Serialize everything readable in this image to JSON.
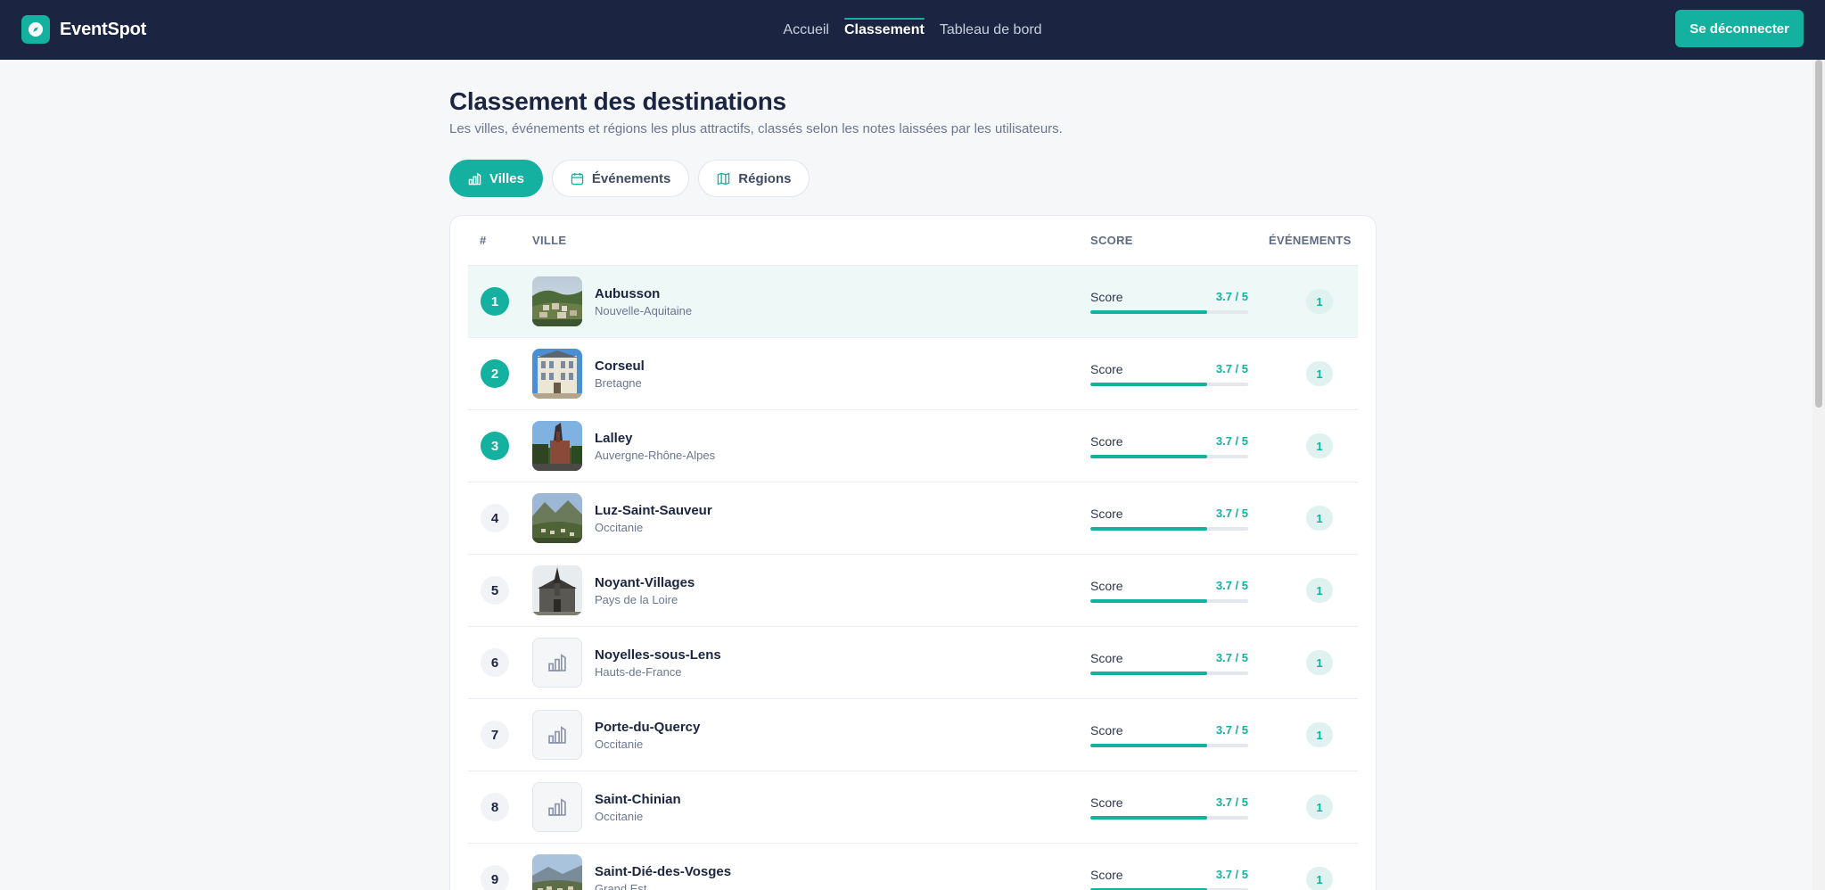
{
  "header": {
    "brand": "EventSpot",
    "nav": [
      {
        "label": "Accueil",
        "active": false
      },
      {
        "label": "Classement",
        "active": true
      },
      {
        "label": "Tableau de bord",
        "active": false
      }
    ],
    "logout_label": "Se déconnecter"
  },
  "page": {
    "title": "Classement des destinations",
    "subtitle": "Les villes, événements et régions les plus attractifs, classés selon les notes laissées par les utilisateurs."
  },
  "tabs": [
    {
      "label": "Villes",
      "icon": "chart-bar-icon",
      "active": true
    },
    {
      "label": "Événements",
      "icon": "calendar-icon",
      "active": false
    },
    {
      "label": "Régions",
      "icon": "map-icon",
      "active": false
    }
  ],
  "table": {
    "columns": {
      "rank": "#",
      "city": "VILLE",
      "score": "SCORE",
      "events": "ÉVÉNEMENTS"
    },
    "score_label": "Score",
    "rows": [
      {
        "rank": "1",
        "name": "Aubusson",
        "region": "Nouvelle-Aquitaine",
        "score": "3.7 / 5",
        "score_fraction": 0.74,
        "events": "1",
        "image": "photo-town-hills"
      },
      {
        "rank": "2",
        "name": "Corseul",
        "region": "Bretagne",
        "score": "3.7 / 5",
        "score_fraction": 0.74,
        "events": "1",
        "image": "photo-building"
      },
      {
        "rank": "3",
        "name": "Lalley",
        "region": "Auvergne-Rhône-Alpes",
        "score": "3.7 / 5",
        "score_fraction": 0.74,
        "events": "1",
        "image": "photo-church-tower"
      },
      {
        "rank": "4",
        "name": "Luz-Saint-Sauveur",
        "region": "Occitanie",
        "score": "3.7 / 5",
        "score_fraction": 0.74,
        "events": "1",
        "image": "photo-valley"
      },
      {
        "rank": "5",
        "name": "Noyant-Villages",
        "region": "Pays de la Loire",
        "score": "3.7 / 5",
        "score_fraction": 0.74,
        "events": "1",
        "image": "photo-church"
      },
      {
        "rank": "6",
        "name": "Noyelles-sous-Lens",
        "region": "Hauts-de-France",
        "score": "3.7 / 5",
        "score_fraction": 0.74,
        "events": "1",
        "image": "city-placeholder-icon"
      },
      {
        "rank": "7",
        "name": "Porte-du-Quercy",
        "region": "Occitanie",
        "score": "3.7 / 5",
        "score_fraction": 0.74,
        "events": "1",
        "image": "city-placeholder-icon"
      },
      {
        "rank": "8",
        "name": "Saint-Chinian",
        "region": "Occitanie",
        "score": "3.7 / 5",
        "score_fraction": 0.74,
        "events": "1",
        "image": "city-placeholder-icon"
      },
      {
        "rank": "9",
        "name": "Saint-Dié-des-Vosges",
        "region": "Grand Est",
        "score": "3.7 / 5",
        "score_fraction": 0.74,
        "events": "1",
        "image": "photo-town-mountains"
      }
    ]
  },
  "colors": {
    "navy": "#1b2541",
    "accent": "#14b0a0",
    "highlight_row": "#eef8f6"
  }
}
